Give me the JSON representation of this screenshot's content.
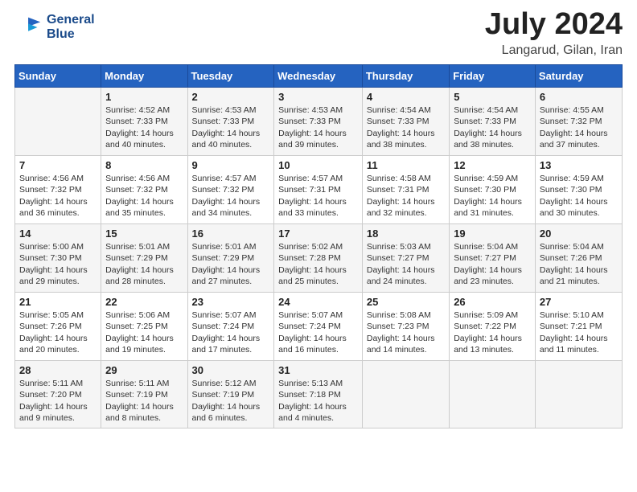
{
  "header": {
    "logo_line1": "General",
    "logo_line2": "Blue",
    "month": "July 2024",
    "location": "Langarud, Gilan, Iran"
  },
  "weekdays": [
    "Sunday",
    "Monday",
    "Tuesday",
    "Wednesday",
    "Thursday",
    "Friday",
    "Saturday"
  ],
  "weeks": [
    [
      {
        "day": "",
        "info": ""
      },
      {
        "day": "1",
        "info": "Sunrise: 4:52 AM\nSunset: 7:33 PM\nDaylight: 14 hours\nand 40 minutes."
      },
      {
        "day": "2",
        "info": "Sunrise: 4:53 AM\nSunset: 7:33 PM\nDaylight: 14 hours\nand 40 minutes."
      },
      {
        "day": "3",
        "info": "Sunrise: 4:53 AM\nSunset: 7:33 PM\nDaylight: 14 hours\nand 39 minutes."
      },
      {
        "day": "4",
        "info": "Sunrise: 4:54 AM\nSunset: 7:33 PM\nDaylight: 14 hours\nand 38 minutes."
      },
      {
        "day": "5",
        "info": "Sunrise: 4:54 AM\nSunset: 7:33 PM\nDaylight: 14 hours\nand 38 minutes."
      },
      {
        "day": "6",
        "info": "Sunrise: 4:55 AM\nSunset: 7:32 PM\nDaylight: 14 hours\nand 37 minutes."
      }
    ],
    [
      {
        "day": "7",
        "info": "Sunrise: 4:56 AM\nSunset: 7:32 PM\nDaylight: 14 hours\nand 36 minutes."
      },
      {
        "day": "8",
        "info": "Sunrise: 4:56 AM\nSunset: 7:32 PM\nDaylight: 14 hours\nand 35 minutes."
      },
      {
        "day": "9",
        "info": "Sunrise: 4:57 AM\nSunset: 7:32 PM\nDaylight: 14 hours\nand 34 minutes."
      },
      {
        "day": "10",
        "info": "Sunrise: 4:57 AM\nSunset: 7:31 PM\nDaylight: 14 hours\nand 33 minutes."
      },
      {
        "day": "11",
        "info": "Sunrise: 4:58 AM\nSunset: 7:31 PM\nDaylight: 14 hours\nand 32 minutes."
      },
      {
        "day": "12",
        "info": "Sunrise: 4:59 AM\nSunset: 7:30 PM\nDaylight: 14 hours\nand 31 minutes."
      },
      {
        "day": "13",
        "info": "Sunrise: 4:59 AM\nSunset: 7:30 PM\nDaylight: 14 hours\nand 30 minutes."
      }
    ],
    [
      {
        "day": "14",
        "info": "Sunrise: 5:00 AM\nSunset: 7:30 PM\nDaylight: 14 hours\nand 29 minutes."
      },
      {
        "day": "15",
        "info": "Sunrise: 5:01 AM\nSunset: 7:29 PM\nDaylight: 14 hours\nand 28 minutes."
      },
      {
        "day": "16",
        "info": "Sunrise: 5:01 AM\nSunset: 7:29 PM\nDaylight: 14 hours\nand 27 minutes."
      },
      {
        "day": "17",
        "info": "Sunrise: 5:02 AM\nSunset: 7:28 PM\nDaylight: 14 hours\nand 25 minutes."
      },
      {
        "day": "18",
        "info": "Sunrise: 5:03 AM\nSunset: 7:27 PM\nDaylight: 14 hours\nand 24 minutes."
      },
      {
        "day": "19",
        "info": "Sunrise: 5:04 AM\nSunset: 7:27 PM\nDaylight: 14 hours\nand 23 minutes."
      },
      {
        "day": "20",
        "info": "Sunrise: 5:04 AM\nSunset: 7:26 PM\nDaylight: 14 hours\nand 21 minutes."
      }
    ],
    [
      {
        "day": "21",
        "info": "Sunrise: 5:05 AM\nSunset: 7:26 PM\nDaylight: 14 hours\nand 20 minutes."
      },
      {
        "day": "22",
        "info": "Sunrise: 5:06 AM\nSunset: 7:25 PM\nDaylight: 14 hours\nand 19 minutes."
      },
      {
        "day": "23",
        "info": "Sunrise: 5:07 AM\nSunset: 7:24 PM\nDaylight: 14 hours\nand 17 minutes."
      },
      {
        "day": "24",
        "info": "Sunrise: 5:07 AM\nSunset: 7:24 PM\nDaylight: 14 hours\nand 16 minutes."
      },
      {
        "day": "25",
        "info": "Sunrise: 5:08 AM\nSunset: 7:23 PM\nDaylight: 14 hours\nand 14 minutes."
      },
      {
        "day": "26",
        "info": "Sunrise: 5:09 AM\nSunset: 7:22 PM\nDaylight: 14 hours\nand 13 minutes."
      },
      {
        "day": "27",
        "info": "Sunrise: 5:10 AM\nSunset: 7:21 PM\nDaylight: 14 hours\nand 11 minutes."
      }
    ],
    [
      {
        "day": "28",
        "info": "Sunrise: 5:11 AM\nSunset: 7:20 PM\nDaylight: 14 hours\nand 9 minutes."
      },
      {
        "day": "29",
        "info": "Sunrise: 5:11 AM\nSunset: 7:19 PM\nDaylight: 14 hours\nand 8 minutes."
      },
      {
        "day": "30",
        "info": "Sunrise: 5:12 AM\nSunset: 7:19 PM\nDaylight: 14 hours\nand 6 minutes."
      },
      {
        "day": "31",
        "info": "Sunrise: 5:13 AM\nSunset: 7:18 PM\nDaylight: 14 hours\nand 4 minutes."
      },
      {
        "day": "",
        "info": ""
      },
      {
        "day": "",
        "info": ""
      },
      {
        "day": "",
        "info": ""
      }
    ]
  ]
}
